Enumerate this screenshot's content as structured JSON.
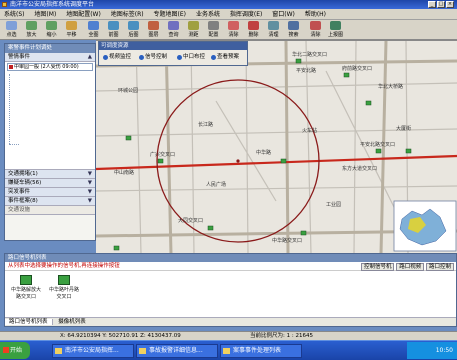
{
  "window": {
    "title": "南洋市公安局指挥系统调度平台"
  },
  "menubar": {
    "items": [
      "系统(S)",
      "地图(M)",
      "地图配置(W)",
      "地图标签(R)",
      "专题地图(E)",
      "业务系统",
      "指挥调度(E)",
      "窗口(W)",
      "帮助(H)"
    ]
  },
  "toolbar": {
    "buttons": [
      "点选",
      "放大",
      "缩小",
      "平移",
      "全图",
      "前图",
      "后图",
      "图层",
      "查询",
      "测距",
      "配置",
      "清除",
      "删除",
      "清理",
      "搜索",
      "清除",
      "上报图"
    ]
  },
  "left_panel": {
    "title": "案警事件计划调处",
    "section1": "警情事件",
    "event_row": "中审园一般 (2人受伤 09:00)",
    "sections": [
      "交通拥堵(1)",
      "嫌疑车辆(56)",
      "突发事件",
      "事件框案(8)"
    ],
    "footer": "交通设施"
  },
  "popup": {
    "title": "可调度资源",
    "buttons": [
      "视频监控",
      "信号控制",
      "中口布控",
      "查看预案"
    ]
  },
  "map": {
    "labels": [
      "平安北路",
      "华北二路交叉口",
      "华北大桥路",
      "环城公园",
      "府前路交叉口",
      "长江路",
      "人民广场",
      "中山南路",
      "广兴交叉口",
      "大厦街",
      "中华路",
      "火车站",
      "平安北路交叉口",
      "东方大道交叉口",
      "中华路交叉口",
      "大同交叉口",
      "工业园"
    ]
  },
  "bottom_panel": {
    "title": "路口信号机列表",
    "tools": [
      "控制信号机",
      "路口视频",
      "路口控制"
    ],
    "warning": "从列表中选择要操作的信号机,再连接操作按钮",
    "devices": [
      {
        "name": "中华路解放大路交叉口",
        "name_short": "中华路解放大道交叉口"
      },
      {
        "name": "中华路叶丹路交叉口",
        "name_short": "中华路叶丹路交叉口"
      }
    ],
    "tabs": [
      "路口信号机列表",
      "摄像机列表"
    ]
  },
  "statusbar": {
    "coords": "X: 64.9210394  Y: 502710.91  Z: 4130437.09",
    "scale": "当前比例尺为: 1 : 21645"
  },
  "taskbar": {
    "start": "开始",
    "tasks": [
      "南洋市公安局指挥...",
      "事故报警详细信息...",
      "案事事件处理列表"
    ],
    "clock": "10:50"
  },
  "colors": {
    "accent": "#3f5f9f",
    "road": "#c8281c",
    "circle": "#8a1a1a"
  }
}
